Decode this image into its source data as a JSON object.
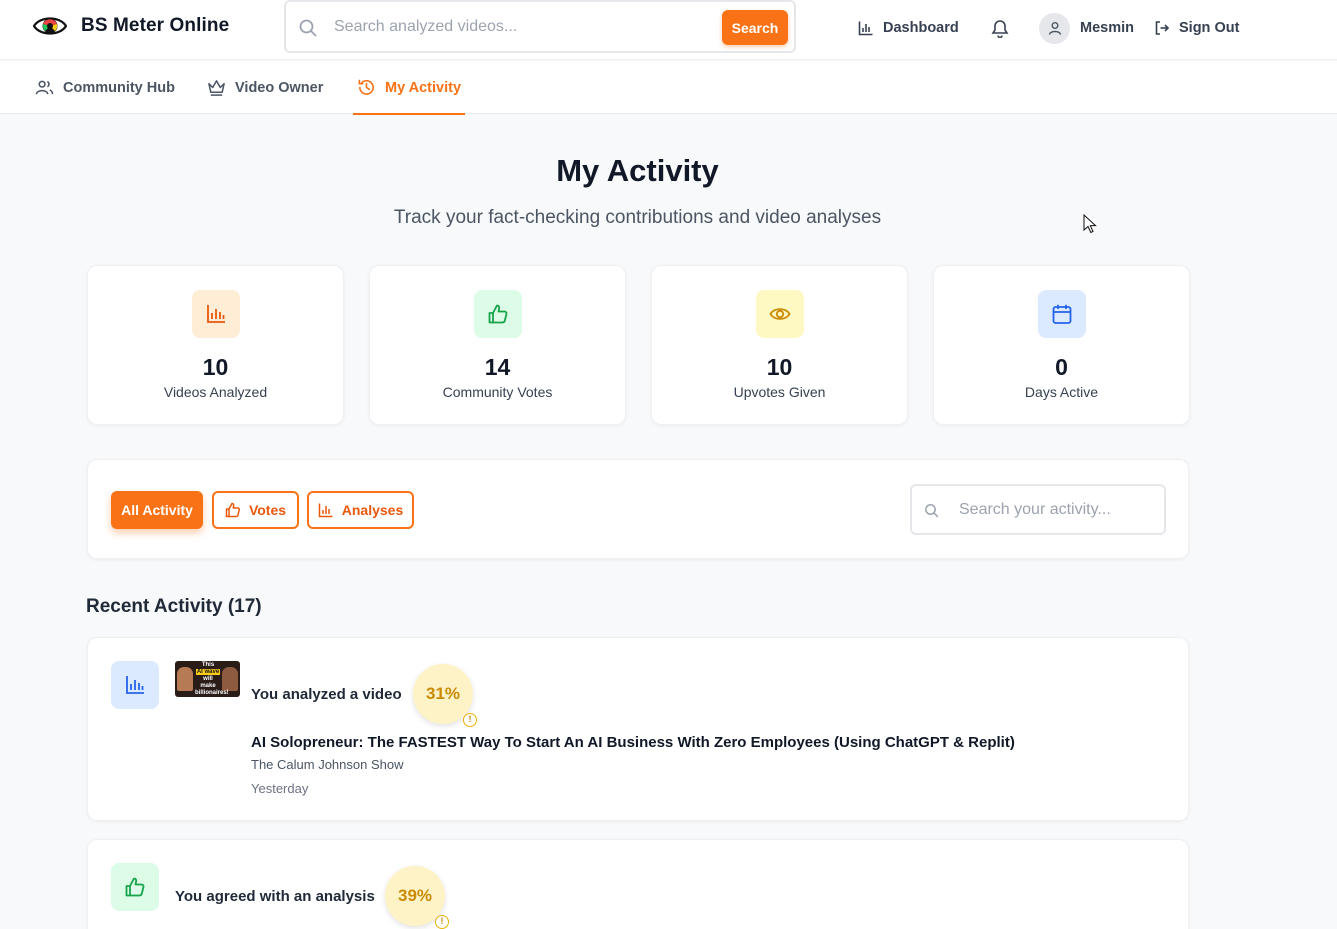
{
  "header": {
    "brand": "BS Meter Online",
    "search_placeholder": "Search analyzed videos...",
    "search_button": "Search",
    "dashboard": "Dashboard",
    "user_name": "Mesmin",
    "sign_out": "Sign Out"
  },
  "tabs": [
    {
      "label": "Community Hub",
      "icon": "users-icon"
    },
    {
      "label": "Video Owner",
      "icon": "crown-icon"
    },
    {
      "label": "My Activity",
      "icon": "history-icon",
      "active": true
    }
  ],
  "page": {
    "title": "My Activity",
    "subtitle": "Track your fact-checking contributions and video analyses"
  },
  "stats": [
    {
      "value": "10",
      "label": "Videos Analyzed",
      "icon": "bar-chart-icon",
      "color": "#ea580c",
      "bg": "#ffedd5"
    },
    {
      "value": "14",
      "label": "Community Votes",
      "icon": "thumbs-up-icon",
      "color": "#16a34a",
      "bg": "#dcfce7"
    },
    {
      "value": "10",
      "label": "Upvotes Given",
      "icon": "eye-icon",
      "color": "#ca8a04",
      "bg": "#fef9c3"
    },
    {
      "value": "0",
      "label": "Days Active",
      "icon": "calendar-icon",
      "color": "#2563eb",
      "bg": "#dbeafe"
    }
  ],
  "filters": {
    "all": "All Activity",
    "votes": "Votes",
    "analyses": "Analyses",
    "search_placeholder": "Search your activity..."
  },
  "recent": {
    "title": "Recent Activity (17)"
  },
  "activities": [
    {
      "text": "You analyzed a video",
      "score": "31%",
      "icon": "bar-chart-icon",
      "thumbnail_caption": [
        "This",
        "AI wave",
        "will make",
        "billionaires!"
      ],
      "video_title": "AI Solopreneur: The FASTEST Way To Start An AI Business With Zero Employees (Using ChatGPT & Replit)",
      "channel": "The Calum Johnson Show",
      "time": "Yesterday"
    },
    {
      "text": "You agreed with an analysis",
      "score": "39%",
      "icon": "thumbs-up-icon"
    }
  ],
  "colors": {
    "accent": "#f97316",
    "score_bg": "#fef3c7",
    "score_text": "#ca8a04"
  }
}
